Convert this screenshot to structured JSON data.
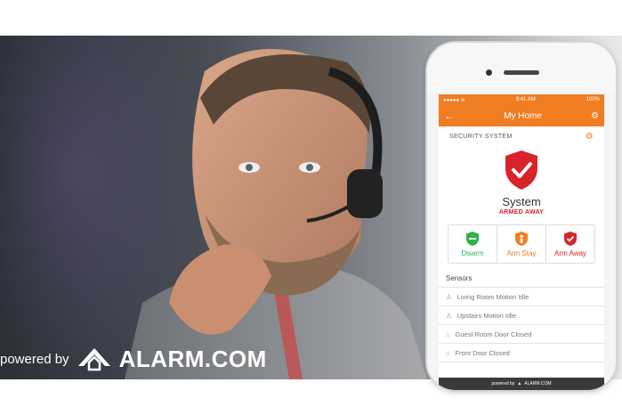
{
  "banner": {
    "powered_by": "powered by",
    "brand": "ALARM.COM"
  },
  "phone": {
    "status": {
      "time": "9:41 AM",
      "battery": "100%"
    },
    "appbar": {
      "title": "My Home"
    },
    "security": {
      "header": "SECURITY SYSTEM",
      "system_label": "System",
      "state": "ARMED AWAY"
    },
    "arm_buttons": [
      {
        "label": "Disarm",
        "color": "#2fb34a"
      },
      {
        "label": "Arm Stay",
        "color": "#f07d22"
      },
      {
        "label": "Arm Away",
        "color": "#d8232a"
      }
    ],
    "sensors": {
      "header": "Sensors",
      "items": [
        {
          "label": "Living Room Motion Idle",
          "icon": "person-icon"
        },
        {
          "label": "Upstairs Motion Idle",
          "icon": "person-icon"
        },
        {
          "label": "Guest Room Door Closed",
          "icon": "door-tag-icon"
        },
        {
          "label": "Front Door Closed",
          "icon": "door-tag-icon"
        }
      ]
    },
    "footer": {
      "powered": "powered by",
      "brand": "ALARM.COM"
    }
  },
  "colors": {
    "accent": "#f07d22",
    "armed": "#d8232a",
    "disarm": "#2fb34a"
  }
}
